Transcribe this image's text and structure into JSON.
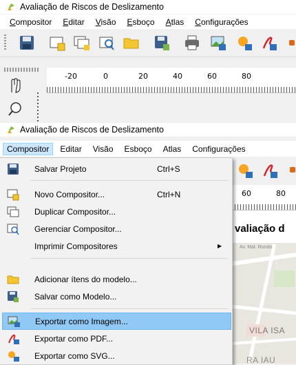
{
  "window": {
    "title": "Avaliação de Riscos de Deslizamento"
  },
  "menubar": {
    "items": [
      {
        "label": "Compositor",
        "accel": "C"
      },
      {
        "label": "Editar",
        "accel": "E"
      },
      {
        "label": "Visão",
        "accel": "V"
      },
      {
        "label": "Esboço",
        "accel": "E"
      },
      {
        "label": "Atlas",
        "accel": "A"
      },
      {
        "label": "Configurações",
        "accel": "C"
      }
    ]
  },
  "ruler": {
    "labels_top": [
      "-20",
      "0",
      "20",
      "40",
      "60",
      "80"
    ],
    "labels_bottom": [
      "60",
      "80"
    ]
  },
  "dropdown": {
    "items": [
      {
        "label": "Salvar Projeto",
        "shortcut": "Ctrl+S",
        "icon": "save-icon"
      },
      {
        "label": "Novo Compositor...",
        "shortcut": "Ctrl+N",
        "icon": "new-composer-icon"
      },
      {
        "label": "Duplicar Compositor...",
        "shortcut": "",
        "icon": "duplicate-composer-icon"
      },
      {
        "label": "Gerenciar Compositor...",
        "shortcut": "",
        "icon": "manage-composer-icon"
      },
      {
        "label": "Imprimir Compositores",
        "shortcut": "",
        "submenu_arrow": "▶"
      },
      {
        "label": "Adicionar ítens do modelo...",
        "shortcut": "",
        "icon": "folder-icon"
      },
      {
        "label": "Salvar como Modelo...",
        "shortcut": "",
        "icon": "save-template-icon"
      },
      {
        "label": "Exportar como Imagem...",
        "shortcut": "",
        "icon": "export-image-icon"
      },
      {
        "label": "Exportar como PDF...",
        "shortcut": "",
        "icon": "export-pdf-icon"
      },
      {
        "label": "Exportar como SVG...",
        "shortcut": "",
        "icon": "export-svg-icon"
      }
    ]
  },
  "map": {
    "title_fragment": "valiação d",
    "street_label": "Av. Mal. Rondo",
    "area_label_1": "VILA ISA",
    "area_label_2": "RA IAU"
  },
  "colors": {
    "highlight": "#90c8f6",
    "menu_selected": "#cce8ff",
    "accent_blue": "#2f6fba"
  }
}
